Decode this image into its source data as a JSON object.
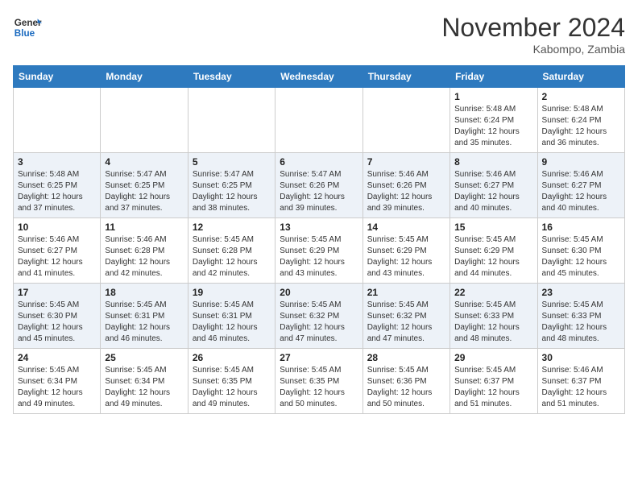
{
  "header": {
    "logo_line1": "General",
    "logo_line2": "Blue",
    "month_title": "November 2024",
    "location": "Kabompo, Zambia"
  },
  "weekdays": [
    "Sunday",
    "Monday",
    "Tuesday",
    "Wednesday",
    "Thursday",
    "Friday",
    "Saturday"
  ],
  "weeks": [
    [
      {
        "day": "",
        "sunrise": "",
        "sunset": "",
        "daylight": ""
      },
      {
        "day": "",
        "sunrise": "",
        "sunset": "",
        "daylight": ""
      },
      {
        "day": "",
        "sunrise": "",
        "sunset": "",
        "daylight": ""
      },
      {
        "day": "",
        "sunrise": "",
        "sunset": "",
        "daylight": ""
      },
      {
        "day": "",
        "sunrise": "",
        "sunset": "",
        "daylight": ""
      },
      {
        "day": "1",
        "sunrise": "Sunrise: 5:48 AM",
        "sunset": "Sunset: 6:24 PM",
        "daylight": "Daylight: 12 hours and 35 minutes."
      },
      {
        "day": "2",
        "sunrise": "Sunrise: 5:48 AM",
        "sunset": "Sunset: 6:24 PM",
        "daylight": "Daylight: 12 hours and 36 minutes."
      }
    ],
    [
      {
        "day": "3",
        "sunrise": "Sunrise: 5:48 AM",
        "sunset": "Sunset: 6:25 PM",
        "daylight": "Daylight: 12 hours and 37 minutes."
      },
      {
        "day": "4",
        "sunrise": "Sunrise: 5:47 AM",
        "sunset": "Sunset: 6:25 PM",
        "daylight": "Daylight: 12 hours and 37 minutes."
      },
      {
        "day": "5",
        "sunrise": "Sunrise: 5:47 AM",
        "sunset": "Sunset: 6:25 PM",
        "daylight": "Daylight: 12 hours and 38 minutes."
      },
      {
        "day": "6",
        "sunrise": "Sunrise: 5:47 AM",
        "sunset": "Sunset: 6:26 PM",
        "daylight": "Daylight: 12 hours and 39 minutes."
      },
      {
        "day": "7",
        "sunrise": "Sunrise: 5:46 AM",
        "sunset": "Sunset: 6:26 PM",
        "daylight": "Daylight: 12 hours and 39 minutes."
      },
      {
        "day": "8",
        "sunrise": "Sunrise: 5:46 AM",
        "sunset": "Sunset: 6:27 PM",
        "daylight": "Daylight: 12 hours and 40 minutes."
      },
      {
        "day": "9",
        "sunrise": "Sunrise: 5:46 AM",
        "sunset": "Sunset: 6:27 PM",
        "daylight": "Daylight: 12 hours and 40 minutes."
      }
    ],
    [
      {
        "day": "10",
        "sunrise": "Sunrise: 5:46 AM",
        "sunset": "Sunset: 6:27 PM",
        "daylight": "Daylight: 12 hours and 41 minutes."
      },
      {
        "day": "11",
        "sunrise": "Sunrise: 5:46 AM",
        "sunset": "Sunset: 6:28 PM",
        "daylight": "Daylight: 12 hours and 42 minutes."
      },
      {
        "day": "12",
        "sunrise": "Sunrise: 5:45 AM",
        "sunset": "Sunset: 6:28 PM",
        "daylight": "Daylight: 12 hours and 42 minutes."
      },
      {
        "day": "13",
        "sunrise": "Sunrise: 5:45 AM",
        "sunset": "Sunset: 6:29 PM",
        "daylight": "Daylight: 12 hours and 43 minutes."
      },
      {
        "day": "14",
        "sunrise": "Sunrise: 5:45 AM",
        "sunset": "Sunset: 6:29 PM",
        "daylight": "Daylight: 12 hours and 43 minutes."
      },
      {
        "day": "15",
        "sunrise": "Sunrise: 5:45 AM",
        "sunset": "Sunset: 6:29 PM",
        "daylight": "Daylight: 12 hours and 44 minutes."
      },
      {
        "day": "16",
        "sunrise": "Sunrise: 5:45 AM",
        "sunset": "Sunset: 6:30 PM",
        "daylight": "Daylight: 12 hours and 45 minutes."
      }
    ],
    [
      {
        "day": "17",
        "sunrise": "Sunrise: 5:45 AM",
        "sunset": "Sunset: 6:30 PM",
        "daylight": "Daylight: 12 hours and 45 minutes."
      },
      {
        "day": "18",
        "sunrise": "Sunrise: 5:45 AM",
        "sunset": "Sunset: 6:31 PM",
        "daylight": "Daylight: 12 hours and 46 minutes."
      },
      {
        "day": "19",
        "sunrise": "Sunrise: 5:45 AM",
        "sunset": "Sunset: 6:31 PM",
        "daylight": "Daylight: 12 hours and 46 minutes."
      },
      {
        "day": "20",
        "sunrise": "Sunrise: 5:45 AM",
        "sunset": "Sunset: 6:32 PM",
        "daylight": "Daylight: 12 hours and 47 minutes."
      },
      {
        "day": "21",
        "sunrise": "Sunrise: 5:45 AM",
        "sunset": "Sunset: 6:32 PM",
        "daylight": "Daylight: 12 hours and 47 minutes."
      },
      {
        "day": "22",
        "sunrise": "Sunrise: 5:45 AM",
        "sunset": "Sunset: 6:33 PM",
        "daylight": "Daylight: 12 hours and 48 minutes."
      },
      {
        "day": "23",
        "sunrise": "Sunrise: 5:45 AM",
        "sunset": "Sunset: 6:33 PM",
        "daylight": "Daylight: 12 hours and 48 minutes."
      }
    ],
    [
      {
        "day": "24",
        "sunrise": "Sunrise: 5:45 AM",
        "sunset": "Sunset: 6:34 PM",
        "daylight": "Daylight: 12 hours and 49 minutes."
      },
      {
        "day": "25",
        "sunrise": "Sunrise: 5:45 AM",
        "sunset": "Sunset: 6:34 PM",
        "daylight": "Daylight: 12 hours and 49 minutes."
      },
      {
        "day": "26",
        "sunrise": "Sunrise: 5:45 AM",
        "sunset": "Sunset: 6:35 PM",
        "daylight": "Daylight: 12 hours and 49 minutes."
      },
      {
        "day": "27",
        "sunrise": "Sunrise: 5:45 AM",
        "sunset": "Sunset: 6:35 PM",
        "daylight": "Daylight: 12 hours and 50 minutes."
      },
      {
        "day": "28",
        "sunrise": "Sunrise: 5:45 AM",
        "sunset": "Sunset: 6:36 PM",
        "daylight": "Daylight: 12 hours and 50 minutes."
      },
      {
        "day": "29",
        "sunrise": "Sunrise: 5:45 AM",
        "sunset": "Sunset: 6:37 PM",
        "daylight": "Daylight: 12 hours and 51 minutes."
      },
      {
        "day": "30",
        "sunrise": "Sunrise: 5:46 AM",
        "sunset": "Sunset: 6:37 PM",
        "daylight": "Daylight: 12 hours and 51 minutes."
      }
    ]
  ]
}
